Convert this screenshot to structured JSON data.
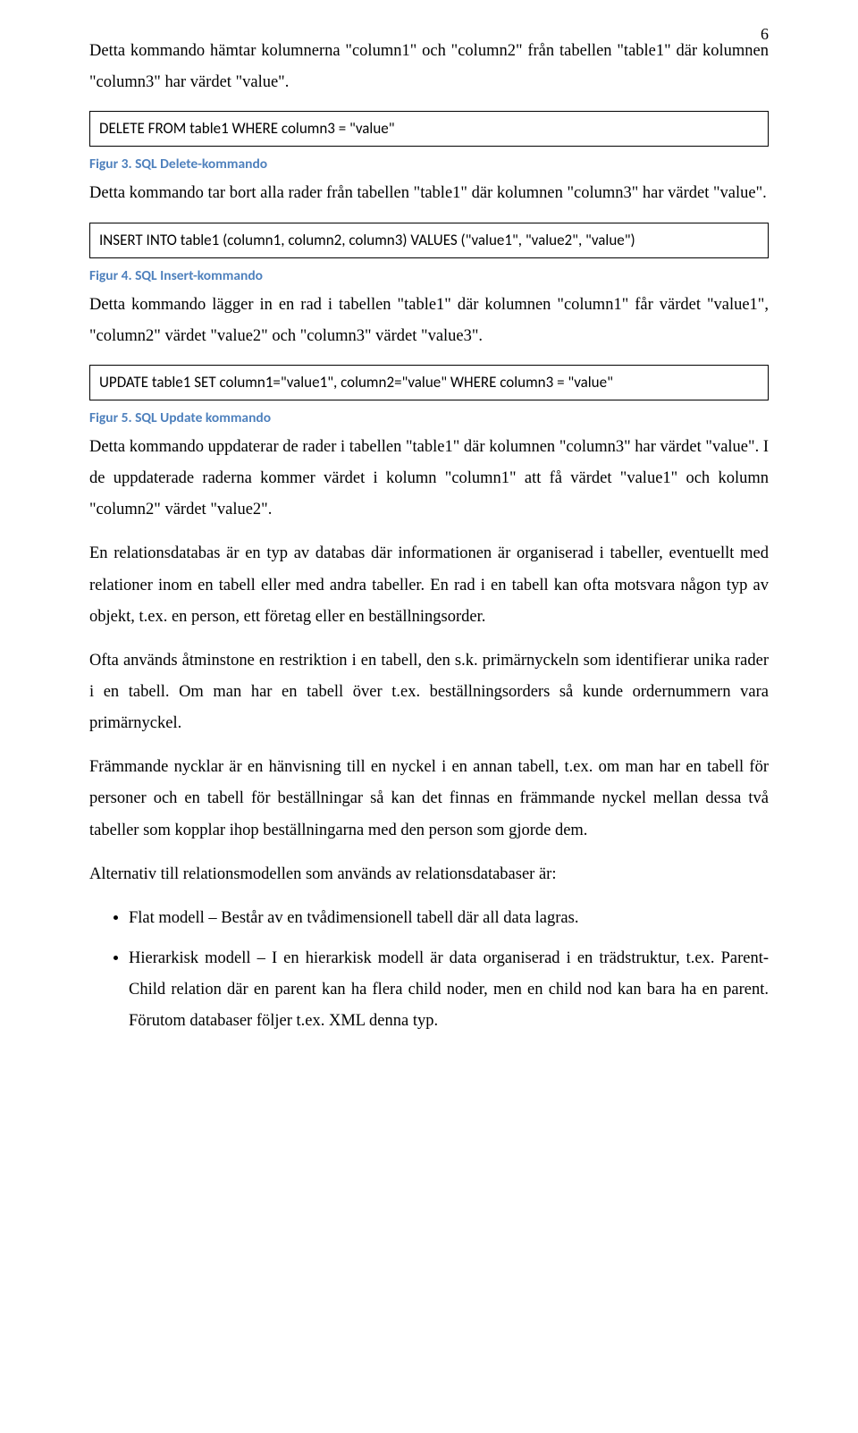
{
  "page_number": "6",
  "paragraphs": {
    "p1": "Detta kommando hämtar kolumnerna \"column1\" och \"column2\" från tabellen \"table1\" där kolumnen \"column3\" har värdet \"value\".",
    "p2": "Detta kommando tar bort alla rader från tabellen \"table1\" där kolumnen \"column3\" har värdet \"value\".",
    "p3": "Detta kommando lägger in en rad i tabellen \"table1\" där kolumnen \"column1\" får värdet \"value1\", \"column2\" värdet \"value2\" och \"column3\" värdet \"value3\".",
    "p4": "Detta kommando uppdaterar de rader i tabellen \"table1\" där kolumnen \"column3\" har värdet \"value\". I de uppdaterade raderna kommer värdet i kolumn \"column1\" att få värdet \"value1\" och kolumn \"column2\" värdet \"value2\".",
    "p5": "En relationsdatabas är en typ av databas där informationen är organiserad i tabeller, eventuellt med relationer inom en tabell eller med andra tabeller. En rad i en tabell kan ofta motsvara någon typ av objekt, t.ex. en person, ett företag eller en beställningsorder.",
    "p6": "Ofta används åtminstone en restriktion i en tabell, den s.k. primärnyckeln som identifierar unika rader i en tabell. Om man har en tabell över t.ex. beställningsorders så kunde ordernummern vara primärnyckel.",
    "p7": "Främmande nycklar är en hänvisning till en nyckel i en annan tabell, t.ex. om man har en tabell för personer och en tabell för beställningar så kan det finnas en främmande nyckel mellan dessa två tabeller som kopplar ihop beställningarna med den person som gjorde dem.",
    "p8": "Alternativ till relationsmodellen som används av relationsdatabaser är:"
  },
  "code": {
    "c1": "DELETE FROM table1 WHERE column3 = \"value\"",
    "c2": "INSERT INTO table1 (column1, column2, column3) VALUES (\"value1\", \"value2\", \"value\")",
    "c3": "UPDATE table1 SET column1=\"value1\", column2=\"value\" WHERE column3 = \"value\""
  },
  "captions": {
    "f3": "Figur 3. SQL Delete-kommando",
    "f4": "Figur 4. SQL Insert-kommando",
    "f5": "Figur 5. SQL Update kommando"
  },
  "bullets": {
    "b1": "Flat modell – Består av en tvådimensionell tabell där all data lagras.",
    "b2": "Hierarkisk modell – I en hierarkisk modell är data organiserad i en trädstruktur, t.ex. Parent-Child relation där en parent kan ha flera child noder, men en child nod kan bara ha en parent. Förutom databaser följer t.ex. XML denna typ."
  }
}
